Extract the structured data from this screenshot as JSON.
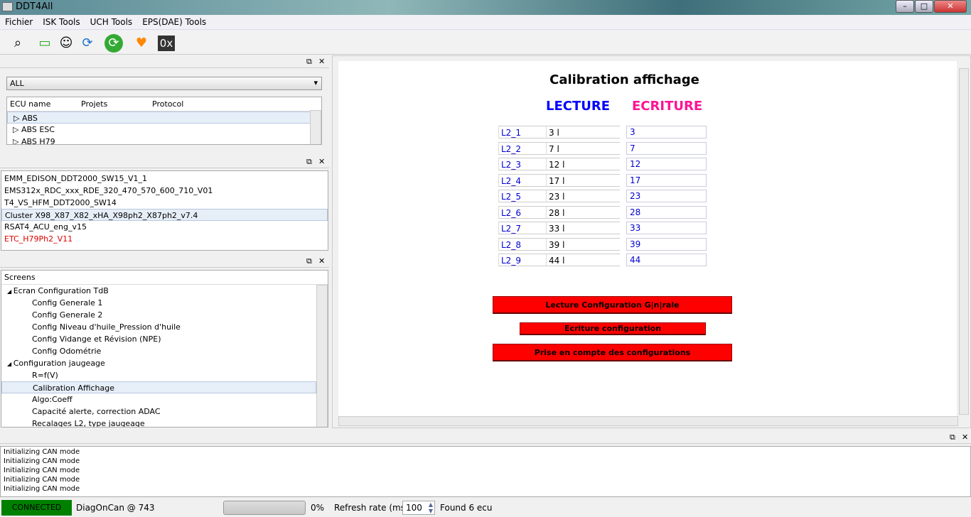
{
  "window": {
    "title": "DDT4All"
  },
  "menu": [
    "Fichier",
    "ISK Tools",
    "UCH Tools",
    "EPS(DAE) Tools"
  ],
  "toolbar": [
    "qr-scan-icon",
    "monitor-icon",
    "smiley-icon",
    "refresh-blue-icon",
    "refresh-green-icon",
    "heart-plus-icon",
    "hex-icon"
  ],
  "toolbar_hex": "0x",
  "ecu_panel": {
    "filter": "ALL",
    "columns": [
      "ECU name",
      "Projets",
      "Protocol"
    ],
    "rows": [
      "ABS",
      "ABS ESC",
      "ABS H79"
    ]
  },
  "project_list": [
    {
      "label": "EMM_EDISON_DDT2000_SW15_V1_1",
      "color": "#000000"
    },
    {
      "label": "EMS312x_RDC_xxx_RDE_320_470_570_600_710_V01",
      "color": "#000000"
    },
    {
      "label": "T4_VS_HFM_DDT2000_SW14",
      "color": "#000000"
    },
    {
      "label": "Cluster X98_X87_X82_xHA_X98ph2_X87ph2_v7.4",
      "color": "#000000"
    },
    {
      "label": "RSAT4_ACU_eng_v15",
      "color": "#000000"
    },
    {
      "label": "ETC_H79Ph2_V11",
      "color": "#e00000"
    }
  ],
  "screens": {
    "header": "Screens",
    "items": [
      {
        "label": "Ecran Configuration TdB",
        "level": 0,
        "expanded": true
      },
      {
        "label": "Config Generale 1",
        "level": 1
      },
      {
        "label": "Config Generale 2",
        "level": 1
      },
      {
        "label": "Config Niveau d'huile_Pression d'huile",
        "level": 1
      },
      {
        "label": "Config Vidange et Révision (NPE)",
        "level": 1
      },
      {
        "label": "Config Odométrie",
        "level": 1
      },
      {
        "label": "Configuration jaugeage",
        "level": 0,
        "expanded": true
      },
      {
        "label": "R=f(V)",
        "level": 1
      },
      {
        "label": "Calibration Affichage",
        "level": 1,
        "selected": true
      },
      {
        "label": "Algo:Coeff",
        "level": 1
      },
      {
        "label": "Capacité alerte, correction ADAC",
        "level": 1
      },
      {
        "label": "Recalages L2, type jaugeage",
        "level": 1
      }
    ]
  },
  "screen": {
    "title": "Calibration affichage",
    "lecture": "LECTURE",
    "ecriture": "ECRITURE",
    "lecture_color": "#0000ff",
    "ecriture_color": "#ff1493",
    "rows": [
      {
        "label": "L2_1",
        "read": "3 l",
        "write": "3"
      },
      {
        "label": "L2_2",
        "read": "7 l",
        "write": "7"
      },
      {
        "label": "L2_3",
        "read": "12 l",
        "write": "12"
      },
      {
        "label": "L2_4",
        "read": "17 l",
        "write": "17"
      },
      {
        "label": "L2_5",
        "read": "23 l",
        "write": "23"
      },
      {
        "label": "L2_6",
        "read": "28 l",
        "write": "28"
      },
      {
        "label": "L2_7",
        "read": "33 l",
        "write": "33"
      },
      {
        "label": "L2_8",
        "read": "39 l",
        "write": "39"
      },
      {
        "label": "L2_9",
        "read": "44 l",
        "write": "44"
      }
    ],
    "buttons": [
      "Lecture Configuration G|n|rale",
      "Ecriture configuration",
      "Prise en compte des configurations"
    ]
  },
  "log": [
    "Initializing CAN mode",
    "Initializing CAN mode",
    "Initializing CAN mode",
    "Initializing CAN mode",
    "Initializing CAN mode"
  ],
  "status": {
    "connection": "CONNECTED",
    "connection_color": "#008000",
    "protocol": "DiagOnCan @ 743",
    "progress_percent": 0,
    "progress_text": "0%",
    "refresh_label": "Refresh rate (ms):",
    "refresh_value": "100",
    "found": "Found 6 ecu"
  }
}
